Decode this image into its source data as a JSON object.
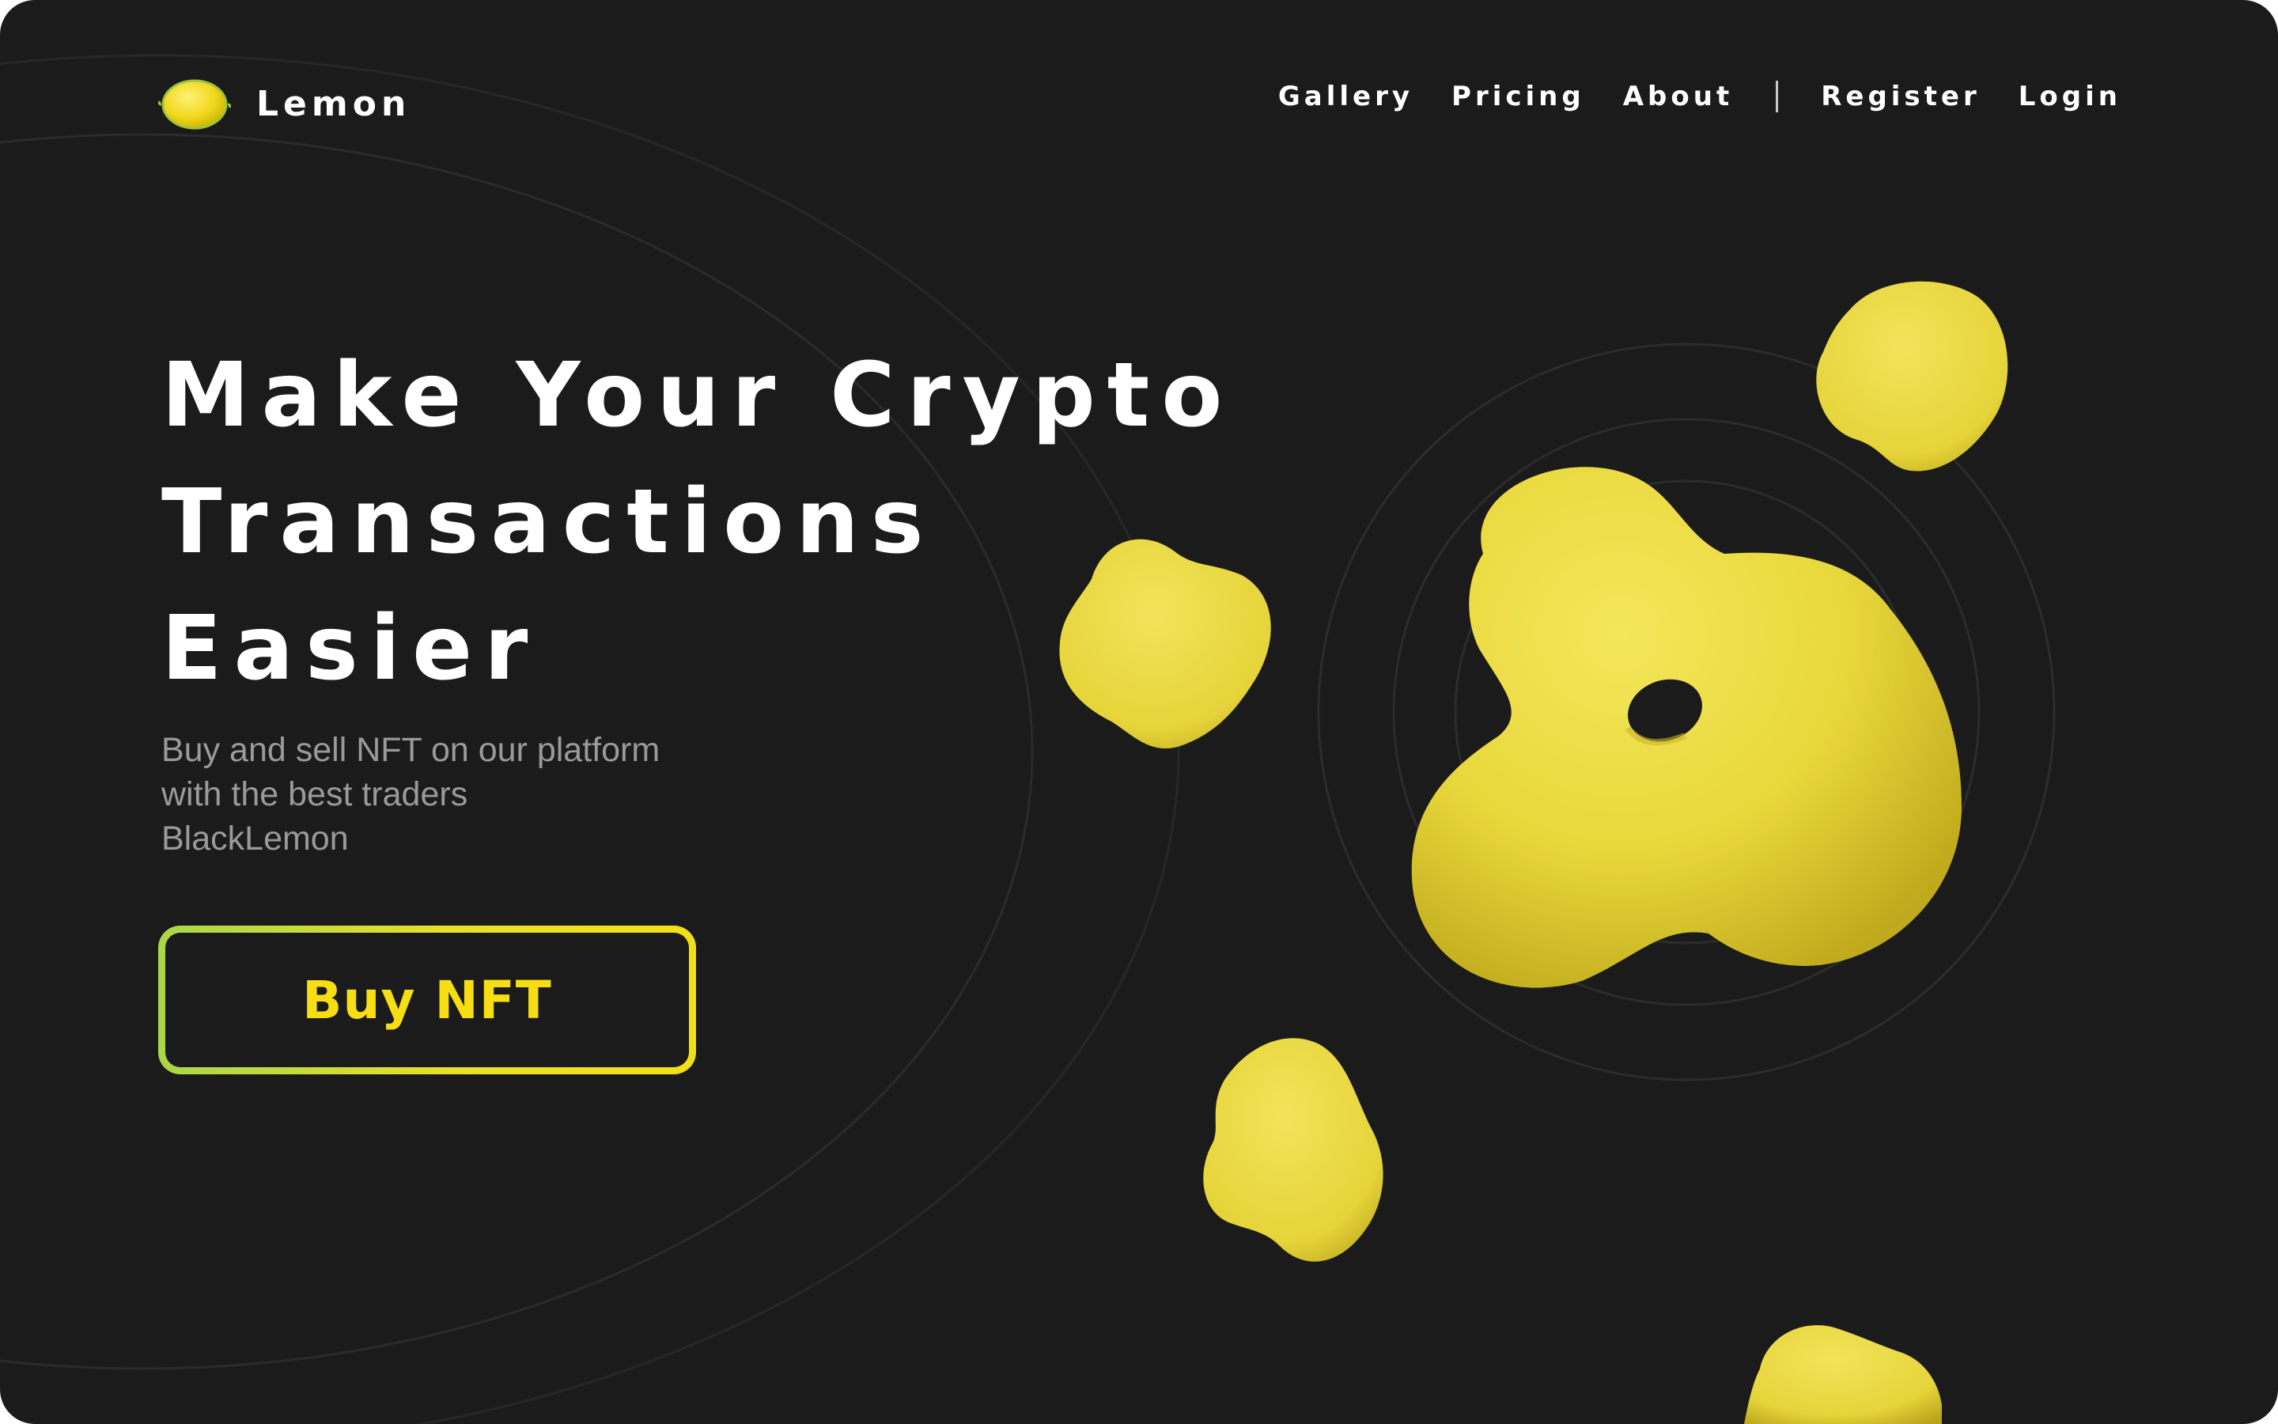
{
  "brand": {
    "name": "Lemon",
    "accent_color": "#f3df17",
    "background_color": "#1b1b1b"
  },
  "nav": {
    "items": [
      "Gallery",
      "Pricing",
      "About"
    ],
    "auth": [
      "Register",
      "Login"
    ]
  },
  "hero": {
    "title_lines": [
      "Make Your Crypto",
      "Transactions",
      "Easier"
    ],
    "subtitle_lines": [
      "Buy and sell NFT on our platform",
      "with the best traders",
      "BlackLemon"
    ],
    "cta_label": "Buy NFT"
  },
  "decor": {
    "blob_color": "#ecdd3f",
    "ring_color": "#2b2b2b"
  }
}
